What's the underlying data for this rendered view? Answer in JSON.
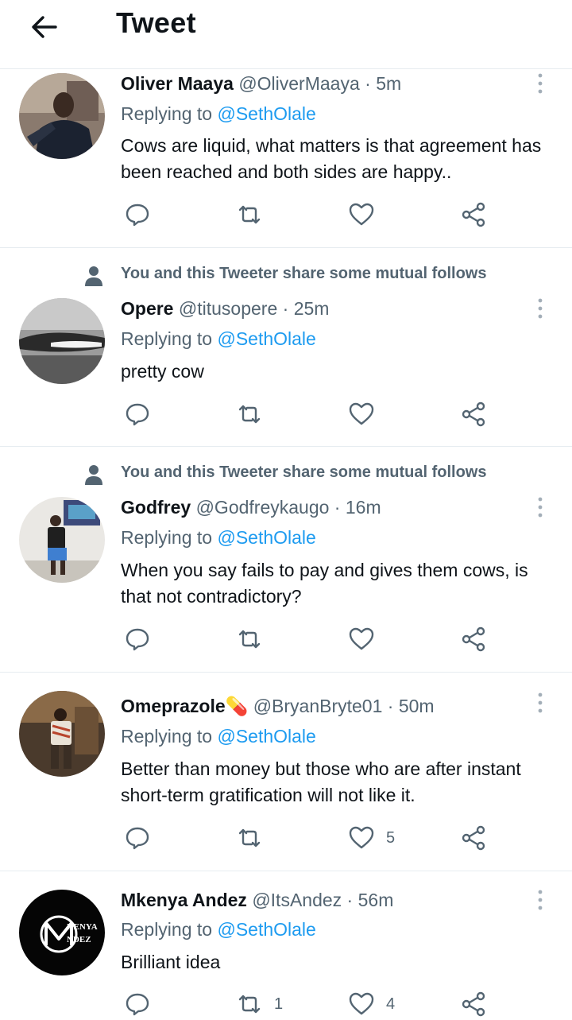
{
  "header": {
    "title": "Tweet",
    "back_icon": "arrow-left-icon"
  },
  "colors": {
    "accent": "#1d9bf0",
    "muted": "#536471",
    "text": "#0f1419",
    "divider": "#e6ecf0"
  },
  "social_context_text": "You and this Tweeter share some mutual follows",
  "tweets": [
    {
      "name": "Oliver Maaya",
      "handle": "@OliverMaaya",
      "dot": "·",
      "time": "5m",
      "reply_prefix": "Replying to",
      "reply_to": "@SethOlale",
      "text": "Cows are liquid, what matters is that agreement has been reached and both sides are happy..",
      "retweets": "",
      "likes": ""
    },
    {
      "name": "Opere",
      "handle": "@titusopere",
      "dot": "·",
      "time": "25m",
      "reply_prefix": "Replying to",
      "reply_to": "@SethOlale",
      "text": "pretty cow",
      "retweets": "",
      "likes": ""
    },
    {
      "name": "Godfrey",
      "handle": "@Godfreykaugo",
      "dot": "·",
      "time": "16m",
      "reply_prefix": "Replying to",
      "reply_to": "@SethOlale",
      "text": "When you say fails to pay and gives them cows, is that not contradictory?",
      "retweets": "",
      "likes": ""
    },
    {
      "name": "Omeprazole",
      "name_emoji": "💊",
      "handle": "@BryanBryte01",
      "dot": "·",
      "time": "50m",
      "reply_prefix": "Replying to",
      "reply_to": "@SethOlale",
      "text": "Better than money but those who are after instant short-term gratification will not like it.",
      "retweets": "",
      "likes": "5"
    },
    {
      "name": "Mkenya Andez",
      "handle": "@ItsAndez",
      "dot": "·",
      "time": "56m",
      "reply_prefix": "Replying to",
      "reply_to": "@SethOlale",
      "text": "Brilliant idea",
      "retweets": "1",
      "likes": "4",
      "avatar_logo_text": [
        "KENYA",
        "NDEZ"
      ]
    }
  ]
}
